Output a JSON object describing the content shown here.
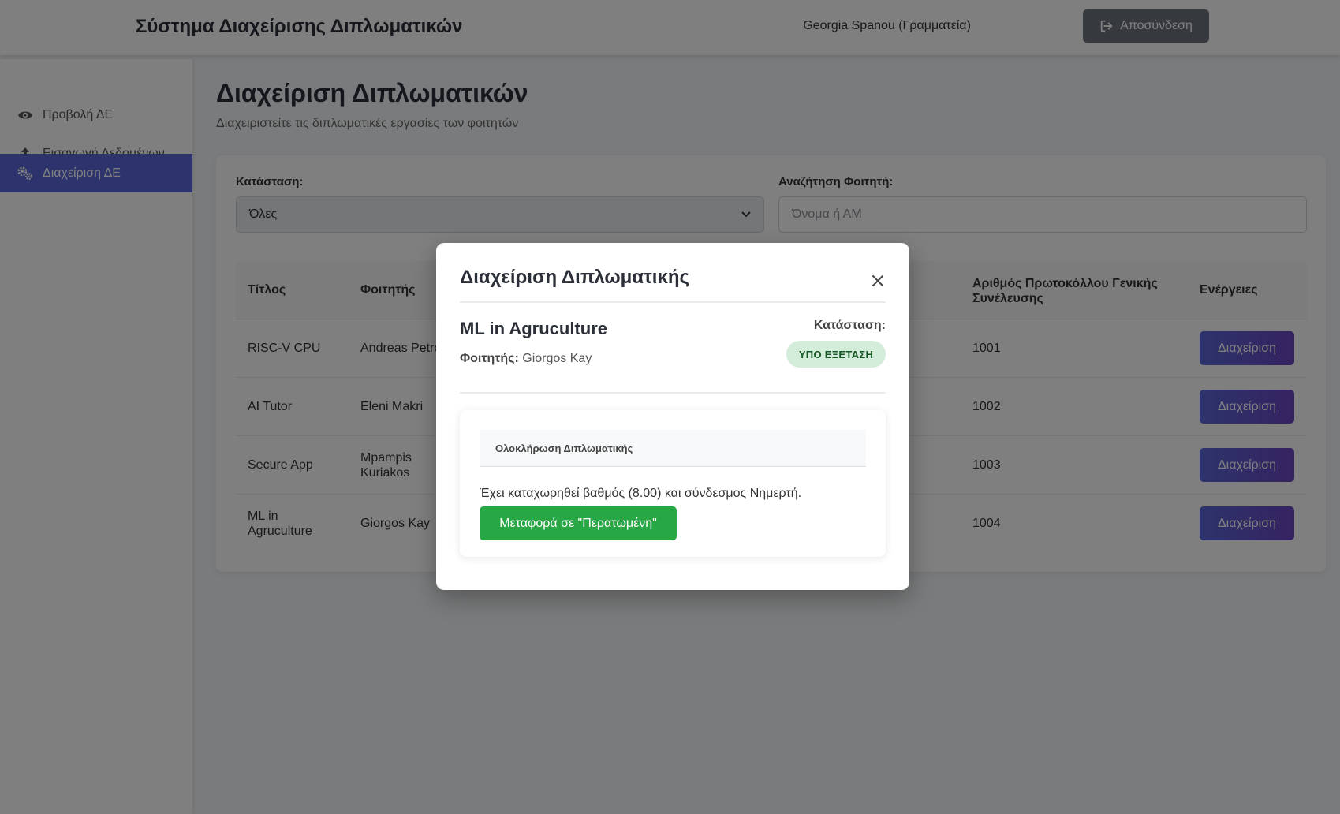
{
  "header": {
    "app_title": "Σύστημα Διαχείρισης Διπλωματικών",
    "user": "Georgia Spanou (Γραμματεία)",
    "logout_label": "Αποσύνδεση"
  },
  "sidebar": {
    "items": [
      {
        "label": "Προβολή ΔΕ",
        "icon": "eye-icon"
      },
      {
        "label": "Εισαγωγή Δεδομένων",
        "icon": "upload-icon"
      },
      {
        "label": "Διαχείριση ΔΕ",
        "icon": "gears-icon",
        "active": true
      }
    ]
  },
  "main": {
    "title": "Διαχείριση Διπλωματικών",
    "subtitle": "Διαχειριστείτε τις διπλωματικές εργασίες των φοιτητών",
    "filters": {
      "status_label": "Κατάσταση:",
      "status_value": "Όλες",
      "search_label": "Αναζήτηση Φοιτητή:",
      "search_placeholder": "Όνομα ή ΑΜ"
    },
    "table": {
      "headers": {
        "title": "Τίτλος",
        "student": "Φοιτητής",
        "protocol_line1": "Αριθμός Πρωτοκόλλου Γενικής",
        "protocol_line2": "Συνέλευσης",
        "actions": "Ενέργειες"
      },
      "rows": [
        {
          "title_l1": "RISC-V CPU",
          "title_l2": "",
          "student_l1": "Andreas Petro",
          "student_l2": "",
          "protocol": "1001",
          "action": "Διαχείριση"
        },
        {
          "title_l1": "AI Tutor",
          "title_l2": "",
          "student_l1": "Eleni Makri",
          "student_l2": "",
          "protocol": "1002",
          "action": "Διαχείριση"
        },
        {
          "title_l1": "Secure App",
          "title_l2": "",
          "student_l1": "Mpampis",
          "student_l2": "Kuriakos",
          "protocol": "1003",
          "action": "Διαχείριση"
        },
        {
          "title_l1": "ML in",
          "title_l2": "Agruculture",
          "student_l1": "Giorgos Kay",
          "student_l2": "",
          "protocol": "1004",
          "action": "Διαχείριση"
        }
      ]
    }
  },
  "modal": {
    "title": "Διαχείριση Διπλωματικής",
    "thesis_title": "ML in Agruculture",
    "student_label": "Φοιτητής:",
    "student_name": "Giorgos Kay",
    "status_label": "Κατάσταση:",
    "status_badge": "ΥΠΟ ΕΞΕΤΑΣΗ",
    "section_header": "Ολοκλήρωση Διπλωματικής",
    "section_text": "Έχει καταχωρηθεί βαθμός (8.00) και σύνδεσμος Νημερτή.",
    "move_button": "Μεταφορά σε \"Περατωμένη\""
  },
  "colors": {
    "accent": "#5a67d8",
    "success": "#28a745",
    "badge_bg": "#d4edda",
    "badge_text": "#155724",
    "logout_bg": "#6c757d"
  }
}
